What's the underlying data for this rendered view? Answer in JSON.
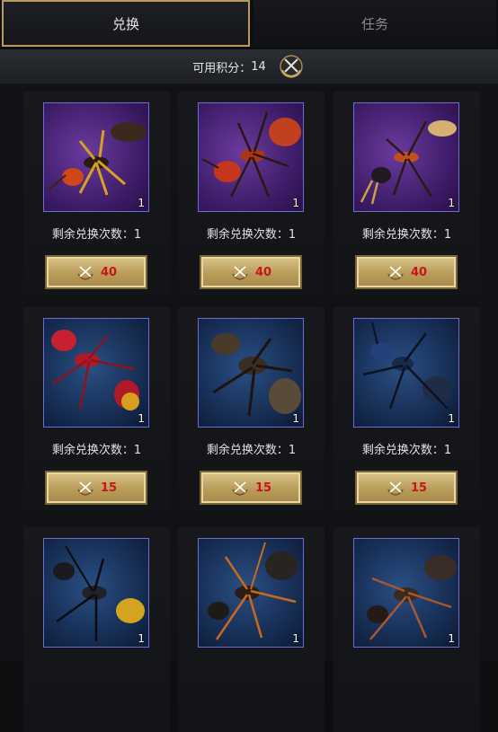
{
  "tabs": [
    {
      "label": "兑换",
      "active": true
    },
    {
      "label": "任务",
      "active": false
    }
  ],
  "points": {
    "label": "可用积分：",
    "value": "14"
  },
  "colors": {
    "accent_gold": "#b99a5c",
    "price_red": "#c8141a",
    "purple_tile": "#4a2578",
    "blue_tile": "#1a335c"
  },
  "items": [
    {
      "tile": "purple",
      "ant": "orange-black",
      "qty": "1",
      "remaining_label": "剩余兑换次数：",
      "remaining": "1",
      "price": "40"
    },
    {
      "tile": "purple",
      "ant": "red",
      "qty": "1",
      "remaining_label": "剩余兑换次数：",
      "remaining": "1",
      "price": "40"
    },
    {
      "tile": "purple",
      "ant": "dark-gold",
      "qty": "1",
      "remaining_label": "剩余兑换次数：",
      "remaining": "1",
      "price": "40"
    },
    {
      "tile": "blue",
      "ant": "red-gold",
      "qty": "1",
      "remaining_label": "剩余兑换次数：",
      "remaining": "1",
      "price": "15"
    },
    {
      "tile": "blue",
      "ant": "brown",
      "qty": "1",
      "remaining_label": "剩余兑换次数：",
      "remaining": "1",
      "price": "15"
    },
    {
      "tile": "blue",
      "ant": "black-blue",
      "qty": "1",
      "remaining_label": "剩余兑换次数：",
      "remaining": "1",
      "price": "15"
    },
    {
      "tile": "blue",
      "ant": "black-gold",
      "qty": "1"
    },
    {
      "tile": "blue",
      "ant": "black-orange",
      "qty": "1"
    },
    {
      "tile": "blue",
      "ant": "black-copper",
      "qty": "1"
    }
  ]
}
